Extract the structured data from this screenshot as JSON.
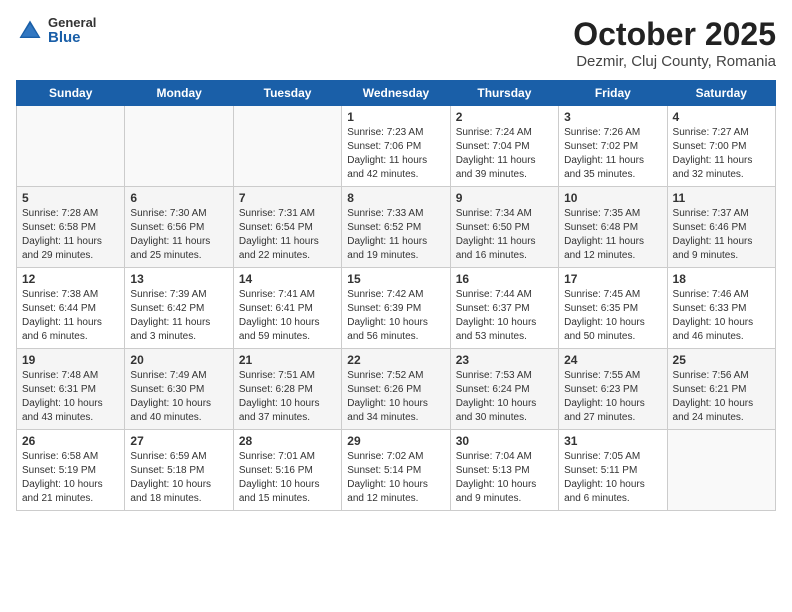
{
  "logo": {
    "general": "General",
    "blue": "Blue"
  },
  "title": {
    "month": "October 2025",
    "location": "Dezmir, Cluj County, Romania"
  },
  "headers": [
    "Sunday",
    "Monday",
    "Tuesday",
    "Wednesday",
    "Thursday",
    "Friday",
    "Saturday"
  ],
  "weeks": [
    [
      {
        "num": "",
        "info": ""
      },
      {
        "num": "",
        "info": ""
      },
      {
        "num": "",
        "info": ""
      },
      {
        "num": "1",
        "info": "Sunrise: 7:23 AM\nSunset: 7:06 PM\nDaylight: 11 hours\nand 42 minutes."
      },
      {
        "num": "2",
        "info": "Sunrise: 7:24 AM\nSunset: 7:04 PM\nDaylight: 11 hours\nand 39 minutes."
      },
      {
        "num": "3",
        "info": "Sunrise: 7:26 AM\nSunset: 7:02 PM\nDaylight: 11 hours\nand 35 minutes."
      },
      {
        "num": "4",
        "info": "Sunrise: 7:27 AM\nSunset: 7:00 PM\nDaylight: 11 hours\nand 32 minutes."
      }
    ],
    [
      {
        "num": "5",
        "info": "Sunrise: 7:28 AM\nSunset: 6:58 PM\nDaylight: 11 hours\nand 29 minutes."
      },
      {
        "num": "6",
        "info": "Sunrise: 7:30 AM\nSunset: 6:56 PM\nDaylight: 11 hours\nand 25 minutes."
      },
      {
        "num": "7",
        "info": "Sunrise: 7:31 AM\nSunset: 6:54 PM\nDaylight: 11 hours\nand 22 minutes."
      },
      {
        "num": "8",
        "info": "Sunrise: 7:33 AM\nSunset: 6:52 PM\nDaylight: 11 hours\nand 19 minutes."
      },
      {
        "num": "9",
        "info": "Sunrise: 7:34 AM\nSunset: 6:50 PM\nDaylight: 11 hours\nand 16 minutes."
      },
      {
        "num": "10",
        "info": "Sunrise: 7:35 AM\nSunset: 6:48 PM\nDaylight: 11 hours\nand 12 minutes."
      },
      {
        "num": "11",
        "info": "Sunrise: 7:37 AM\nSunset: 6:46 PM\nDaylight: 11 hours\nand 9 minutes."
      }
    ],
    [
      {
        "num": "12",
        "info": "Sunrise: 7:38 AM\nSunset: 6:44 PM\nDaylight: 11 hours\nand 6 minutes."
      },
      {
        "num": "13",
        "info": "Sunrise: 7:39 AM\nSunset: 6:42 PM\nDaylight: 11 hours\nand 3 minutes."
      },
      {
        "num": "14",
        "info": "Sunrise: 7:41 AM\nSunset: 6:41 PM\nDaylight: 10 hours\nand 59 minutes."
      },
      {
        "num": "15",
        "info": "Sunrise: 7:42 AM\nSunset: 6:39 PM\nDaylight: 10 hours\nand 56 minutes."
      },
      {
        "num": "16",
        "info": "Sunrise: 7:44 AM\nSunset: 6:37 PM\nDaylight: 10 hours\nand 53 minutes."
      },
      {
        "num": "17",
        "info": "Sunrise: 7:45 AM\nSunset: 6:35 PM\nDaylight: 10 hours\nand 50 minutes."
      },
      {
        "num": "18",
        "info": "Sunrise: 7:46 AM\nSunset: 6:33 PM\nDaylight: 10 hours\nand 46 minutes."
      }
    ],
    [
      {
        "num": "19",
        "info": "Sunrise: 7:48 AM\nSunset: 6:31 PM\nDaylight: 10 hours\nand 43 minutes."
      },
      {
        "num": "20",
        "info": "Sunrise: 7:49 AM\nSunset: 6:30 PM\nDaylight: 10 hours\nand 40 minutes."
      },
      {
        "num": "21",
        "info": "Sunrise: 7:51 AM\nSunset: 6:28 PM\nDaylight: 10 hours\nand 37 minutes."
      },
      {
        "num": "22",
        "info": "Sunrise: 7:52 AM\nSunset: 6:26 PM\nDaylight: 10 hours\nand 34 minutes."
      },
      {
        "num": "23",
        "info": "Sunrise: 7:53 AM\nSunset: 6:24 PM\nDaylight: 10 hours\nand 30 minutes."
      },
      {
        "num": "24",
        "info": "Sunrise: 7:55 AM\nSunset: 6:23 PM\nDaylight: 10 hours\nand 27 minutes."
      },
      {
        "num": "25",
        "info": "Sunrise: 7:56 AM\nSunset: 6:21 PM\nDaylight: 10 hours\nand 24 minutes."
      }
    ],
    [
      {
        "num": "26",
        "info": "Sunrise: 6:58 AM\nSunset: 5:19 PM\nDaylight: 10 hours\nand 21 minutes."
      },
      {
        "num": "27",
        "info": "Sunrise: 6:59 AM\nSunset: 5:18 PM\nDaylight: 10 hours\nand 18 minutes."
      },
      {
        "num": "28",
        "info": "Sunrise: 7:01 AM\nSunset: 5:16 PM\nDaylight: 10 hours\nand 15 minutes."
      },
      {
        "num": "29",
        "info": "Sunrise: 7:02 AM\nSunset: 5:14 PM\nDaylight: 10 hours\nand 12 minutes."
      },
      {
        "num": "30",
        "info": "Sunrise: 7:04 AM\nSunset: 5:13 PM\nDaylight: 10 hours\nand 9 minutes."
      },
      {
        "num": "31",
        "info": "Sunrise: 7:05 AM\nSunset: 5:11 PM\nDaylight: 10 hours\nand 6 minutes."
      },
      {
        "num": "",
        "info": ""
      }
    ]
  ]
}
